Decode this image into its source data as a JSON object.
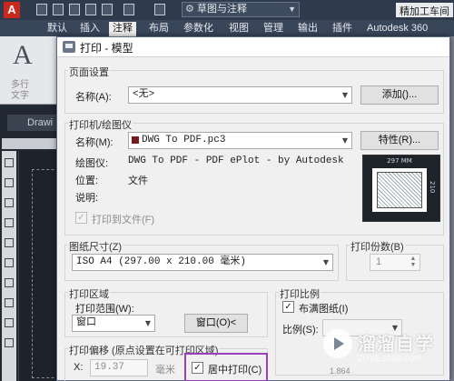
{
  "app": {
    "workspace": "草图与注释",
    "file_title": "精加工车间",
    "ribbon_tabs": [
      "默认",
      "插入",
      "注释",
      "布局",
      "参数化",
      "视图",
      "管理",
      "输出",
      "插件",
      "Autodesk 360"
    ],
    "active_tab": "注释",
    "ribbon_group": [
      "多行",
      "文字"
    ],
    "doc_tab": "Drawi"
  },
  "dialog": {
    "title": "打印 - 模型",
    "page_setup": {
      "group_label": "页面设置",
      "name_label": "名称(A):",
      "name_value": "<无>",
      "add_button": "添加()..."
    },
    "printer": {
      "group_label": "打印机/绘图仪",
      "name_label": "名称(M):",
      "name_value": "DWG To PDF.pc3",
      "properties_button": "特性(R)...",
      "plotter_label": "绘图仪:",
      "plotter_value": "DWG To PDF - PDF ePlot - by Autodesk",
      "location_label": "位置:",
      "location_value": "文件",
      "description_label": "说明:",
      "print_to_file_label": "打印到文件(F)",
      "print_to_file_checked": true,
      "preview_width": "297 MM",
      "preview_height": "210"
    },
    "paper_size": {
      "group_label": "图纸尺寸(Z)",
      "value": "ISO A4 (297.00 x 210.00 毫米)"
    },
    "copies": {
      "group_label": "打印份数(B)",
      "value": "1"
    },
    "plot_area": {
      "group_label": "打印区域",
      "range_label": "打印范围(W):",
      "range_value": "窗口",
      "window_button": "窗口(O)<"
    },
    "plot_scale": {
      "group_label": "打印比例",
      "fit_label": "布满图纸(I)",
      "fit_checked": true,
      "scale_label": "比例(S):"
    },
    "plot_offset": {
      "group_label": "打印偏移 (原点设置在可打印区域)",
      "x_label": "X:",
      "x_value": "19.37",
      "x_unit": "毫米",
      "center_label": "居中打印(C)",
      "center_checked": true,
      "bottom_value": "1.864"
    },
    "highlight_color": "#9b3fbf"
  },
  "watermark": {
    "text": "溜溜自学",
    "sub": "ZIXUE.3D66.COM"
  }
}
